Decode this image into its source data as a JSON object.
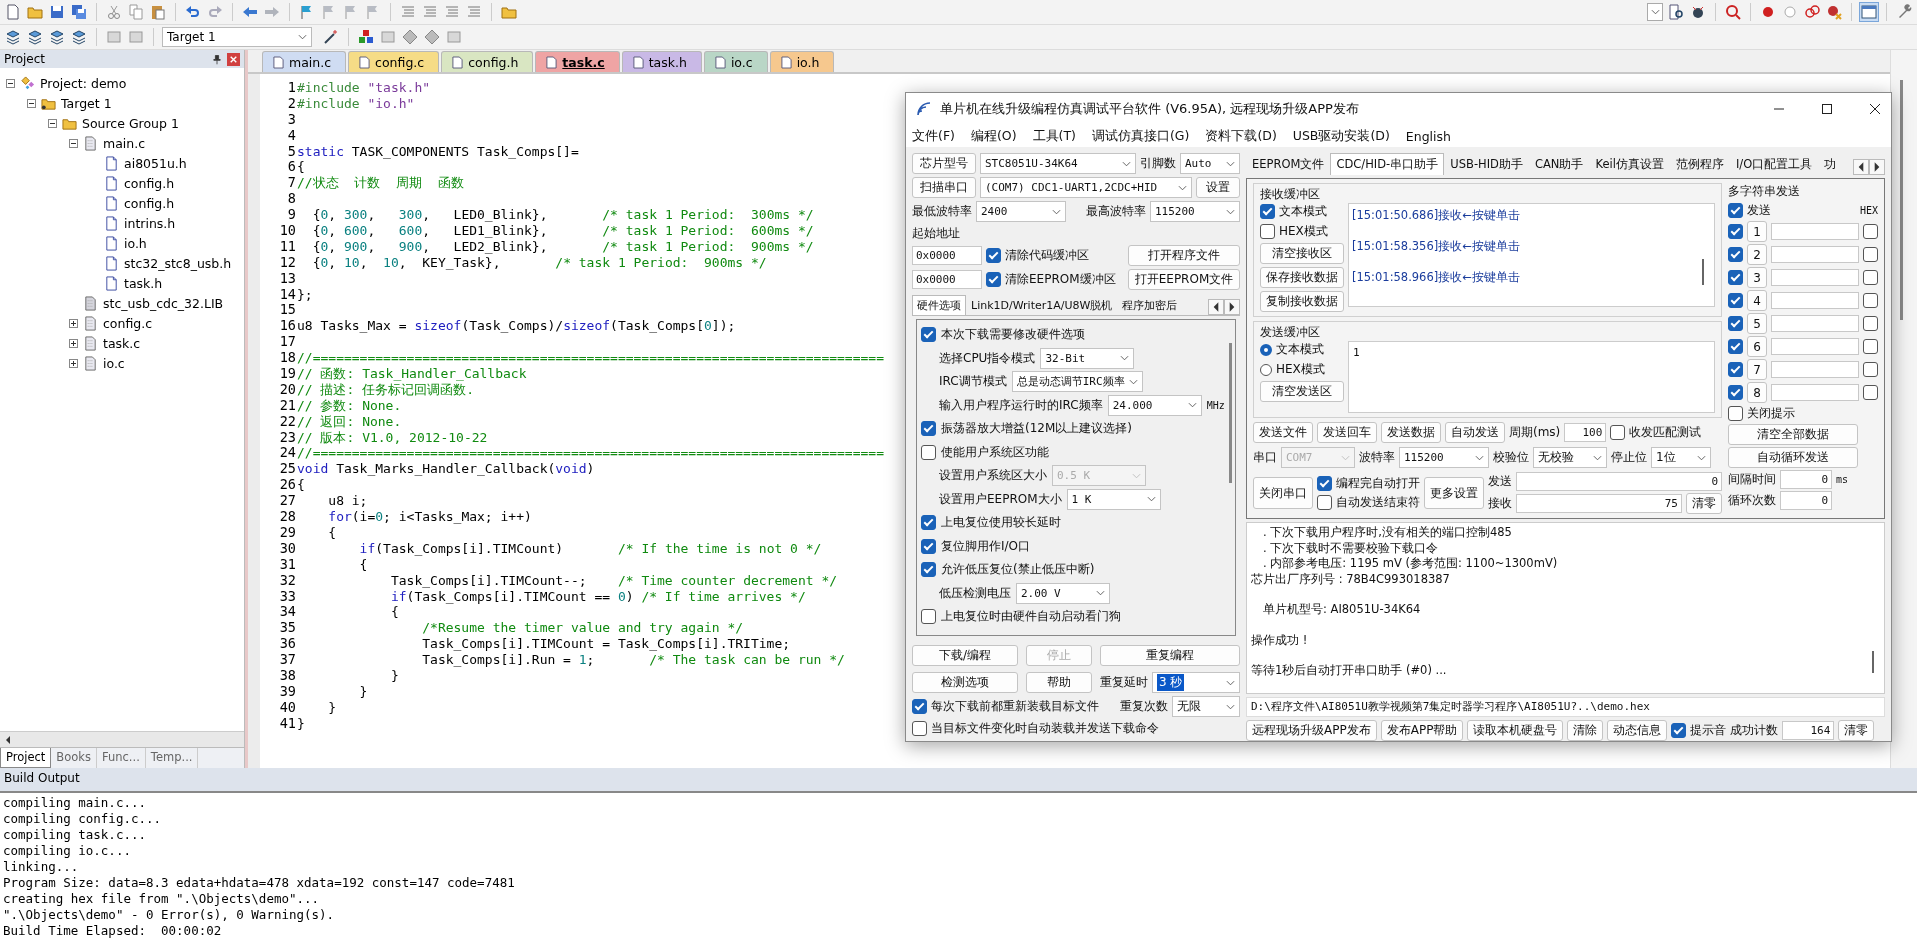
{
  "toolbar": {
    "target": "Target 1"
  },
  "project_panel": {
    "title": "Project",
    "tree": [
      {
        "label": "Project: demo",
        "kind": "project",
        "expanded": true,
        "children": [
          {
            "label": "Target 1",
            "kind": "target",
            "expanded": true,
            "children": [
              {
                "label": "Source Group 1",
                "kind": "group",
                "expanded": true,
                "children": [
                  {
                    "label": "main.c",
                    "kind": "source",
                    "expanded": true,
                    "children": [
                      {
                        "label": "ai8051u.h",
                        "kind": "header"
                      },
                      {
                        "label": "config.h",
                        "kind": "header"
                      },
                      {
                        "label": "config.h",
                        "kind": "header"
                      },
                      {
                        "label": "intrins.h",
                        "kind": "header"
                      },
                      {
                        "label": "io.h",
                        "kind": "header"
                      },
                      {
                        "label": "stc32_stc8_usb.h",
                        "kind": "header"
                      },
                      {
                        "label": "task.h",
                        "kind": "header"
                      }
                    ]
                  },
                  {
                    "label": "stc_usb_cdc_32.LIB",
                    "kind": "library"
                  },
                  {
                    "label": "config.c",
                    "kind": "source",
                    "expanded": false
                  },
                  {
                    "label": "task.c",
                    "kind": "source",
                    "expanded": false
                  },
                  {
                    "label": "io.c",
                    "kind": "source",
                    "expanded": false
                  }
                ]
              }
            ]
          }
        ]
      }
    ],
    "tabs": [
      {
        "label": "Project",
        "selected": true
      },
      {
        "label": "Books",
        "selected": false
      },
      {
        "label": "Func...",
        "selected": false
      },
      {
        "label": "Temp...",
        "selected": false
      }
    ]
  },
  "editor": {
    "tabs": [
      {
        "label": "main.c",
        "color": "#cfdcf2",
        "selected": false
      },
      {
        "label": "config.c",
        "color": "#f6dc86",
        "selected": false
      },
      {
        "label": "config.h",
        "color": "#d9e6c2",
        "selected": false
      },
      {
        "label": "task.c",
        "color": "#efa4a4",
        "selected": true
      },
      {
        "label": "task.h",
        "color": "#c9b9e6",
        "selected": false
      },
      {
        "label": "io.c",
        "color": "#b9d6c6",
        "selected": false
      },
      {
        "label": "io.h",
        "color": "#f6c88e",
        "selected": false
      }
    ],
    "lines": [
      {
        "number": "1",
        "parts": [
          {
            "kind": "pre",
            "text": "#include"
          },
          {
            "kind": "str",
            "text": " \"task.h\""
          }
        ]
      },
      {
        "number": "2",
        "parts": [
          {
            "kind": "pre",
            "text": "#include"
          },
          {
            "kind": "str",
            "text": " \"io.h\""
          }
        ]
      },
      {
        "number": "3"
      },
      {
        "number": "4"
      },
      {
        "number": "5",
        "parts": [
          {
            "kind": "kw",
            "text": "static"
          },
          {
            "kind": "plain",
            "text": " TASK_COMPONENTS Task_Comps[]="
          }
        ]
      },
      {
        "number": "6",
        "parts": [
          {
            "kind": "plain",
            "text": "{"
          }
        ]
      },
      {
        "number": "7",
        "parts": [
          {
            "kind": "cm",
            "text": "//状态  计数  周期  函数"
          }
        ]
      },
      {
        "number": "8"
      },
      {
        "number": "9",
        "parts": [
          {
            "kind": "plain",
            "text": "  {"
          },
          {
            "kind": "num",
            "text": "0"
          },
          {
            "kind": "plain",
            "text": ", "
          },
          {
            "kind": "num",
            "text": "300"
          },
          {
            "kind": "plain",
            "text": ",   "
          },
          {
            "kind": "num",
            "text": "300"
          },
          {
            "kind": "plain",
            "text": ",   LED0_Blink},       "
          },
          {
            "kind": "cm",
            "text": "/* task 1 Period:  300ms */"
          }
        ]
      },
      {
        "number": "10",
        "parts": [
          {
            "kind": "plain",
            "text": "  {"
          },
          {
            "kind": "num",
            "text": "0"
          },
          {
            "kind": "plain",
            "text": ", "
          },
          {
            "kind": "num",
            "text": "600"
          },
          {
            "kind": "plain",
            "text": ",   "
          },
          {
            "kind": "num",
            "text": "600"
          },
          {
            "kind": "plain",
            "text": ",   LED1_Blink},       "
          },
          {
            "kind": "cm",
            "text": "/* task 1 Period:  600ms */"
          }
        ]
      },
      {
        "number": "11",
        "parts": [
          {
            "kind": "plain",
            "text": "  {"
          },
          {
            "kind": "num",
            "text": "0"
          },
          {
            "kind": "plain",
            "text": ", "
          },
          {
            "kind": "num",
            "text": "900"
          },
          {
            "kind": "plain",
            "text": ",   "
          },
          {
            "kind": "num",
            "text": "900"
          },
          {
            "kind": "plain",
            "text": ",   LED2_Blink},       "
          },
          {
            "kind": "cm",
            "text": "/* task 1 Period:  900ms */"
          }
        ]
      },
      {
        "number": "12",
        "parts": [
          {
            "kind": "plain",
            "text": "  {"
          },
          {
            "kind": "num",
            "text": "0"
          },
          {
            "kind": "plain",
            "text": ", "
          },
          {
            "kind": "num",
            "text": "10"
          },
          {
            "kind": "plain",
            "text": ",  "
          },
          {
            "kind": "num",
            "text": "10"
          },
          {
            "kind": "plain",
            "text": ",  KEY_Task},       "
          },
          {
            "kind": "cm",
            "text": "/* task 1 Period:  900ms */"
          }
        ]
      },
      {
        "number": "13"
      },
      {
        "number": "14",
        "parts": [
          {
            "kind": "plain",
            "text": "};"
          }
        ]
      },
      {
        "number": "15"
      },
      {
        "number": "16",
        "parts": [
          {
            "kind": "plain",
            "text": "u8 Tasks_Max = "
          },
          {
            "kind": "kw",
            "text": "sizeof"
          },
          {
            "kind": "plain",
            "text": "(Task_Comps)/"
          },
          {
            "kind": "kw",
            "text": "sizeof"
          },
          {
            "kind": "plain",
            "text": "(Task_Comps["
          },
          {
            "kind": "num",
            "text": "0"
          },
          {
            "kind": "plain",
            "text": "]);"
          }
        ]
      },
      {
        "number": "17"
      },
      {
        "number": "18",
        "parts": [
          {
            "kind": "cm",
            "text": "//========================================================================="
          }
        ]
      },
      {
        "number": "19",
        "parts": [
          {
            "kind": "cm",
            "text": "// 函数: Task_Handler_Callback"
          }
        ]
      },
      {
        "number": "20",
        "parts": [
          {
            "kind": "cm",
            "text": "// 描述: 任务标记回调函数."
          }
        ]
      },
      {
        "number": "21",
        "parts": [
          {
            "kind": "cm",
            "text": "// 参数: None."
          }
        ]
      },
      {
        "number": "22",
        "parts": [
          {
            "kind": "cm",
            "text": "// 返回: None."
          }
        ]
      },
      {
        "number": "23",
        "parts": [
          {
            "kind": "cm",
            "text": "// 版本: V1.0, 2012-10-22"
          }
        ]
      },
      {
        "number": "24",
        "parts": [
          {
            "kind": "cm",
            "text": "//========================================================================="
          }
        ]
      },
      {
        "number": "25",
        "parts": [
          {
            "kind": "kw",
            "text": "void"
          },
          {
            "kind": "plain",
            "text": " Task_Marks_Handler_Callback("
          },
          {
            "kind": "kw",
            "text": "void"
          },
          {
            "kind": "plain",
            "text": ")"
          }
        ]
      },
      {
        "number": "26",
        "parts": [
          {
            "kind": "plain",
            "text": "{"
          }
        ]
      },
      {
        "number": "27",
        "parts": [
          {
            "kind": "plain",
            "text": "    u8 i;"
          }
        ]
      },
      {
        "number": "28",
        "parts": [
          {
            "kind": "kw",
            "text": "    for"
          },
          {
            "kind": "plain",
            "text": "(i="
          },
          {
            "kind": "num",
            "text": "0"
          },
          {
            "kind": "plain",
            "text": "; i<Tasks_Max; i++)"
          }
        ]
      },
      {
        "number": "29",
        "parts": [
          {
            "kind": "plain",
            "text": "    {"
          }
        ]
      },
      {
        "number": "30",
        "parts": [
          {
            "kind": "kw",
            "text": "        if"
          },
          {
            "kind": "plain",
            "text": "(Task_Comps[i].TIMCount)       "
          },
          {
            "kind": "cm",
            "text": "/* If the time is not 0 */"
          }
        ]
      },
      {
        "number": "31",
        "parts": [
          {
            "kind": "plain",
            "text": "        {"
          }
        ]
      },
      {
        "number": "32",
        "parts": [
          {
            "kind": "plain",
            "text": "            Task_Comps[i].TIMCount--;    "
          },
          {
            "kind": "cm",
            "text": "/* Time counter decrement */"
          }
        ]
      },
      {
        "number": "33",
        "parts": [
          {
            "kind": "kw",
            "text": "            if"
          },
          {
            "kind": "plain",
            "text": "(Task_Comps[i].TIMCount == "
          },
          {
            "kind": "num",
            "text": "0"
          },
          {
            "kind": "plain",
            "text": ") "
          },
          {
            "kind": "cm",
            "text": "/* If time arrives */"
          }
        ]
      },
      {
        "number": "34",
        "parts": [
          {
            "kind": "plain",
            "text": "            {"
          }
        ]
      },
      {
        "number": "35",
        "parts": [
          {
            "kind": "cm",
            "text": "                /*Resume the timer value and try again */"
          }
        ]
      },
      {
        "number": "36",
        "parts": [
          {
            "kind": "plain",
            "text": "                Task_Comps[i].TIMCount = Task_Comps[i].TRITime;"
          }
        ]
      },
      {
        "number": "37",
        "parts": [
          {
            "kind": "plain",
            "text": "                Task_Comps[i].Run = "
          },
          {
            "kind": "num",
            "text": "1"
          },
          {
            "kind": "plain",
            "text": ";       "
          },
          {
            "kind": "cm",
            "text": "/* The task can be run */"
          }
        ]
      },
      {
        "number": "38",
        "parts": [
          {
            "kind": "plain",
            "text": "            }"
          }
        ]
      },
      {
        "number": "39",
        "parts": [
          {
            "kind": "plain",
            "text": "        }"
          }
        ]
      },
      {
        "number": "40",
        "parts": [
          {
            "kind": "plain",
            "text": "    }"
          }
        ]
      },
      {
        "number": "41",
        "parts": [
          {
            "kind": "plain",
            "text": "}"
          }
        ]
      }
    ]
  },
  "build_output": {
    "title": "Build Output",
    "lines": [
      "compiling main.c...",
      "compiling config.c...",
      "compiling task.c...",
      "compiling io.c...",
      "linking...",
      "Program Size: data=8.3 edata+hdata=478 xdata=192 const=147 code=7481",
      "creating hex file from \".\\Objects\\demo\"...",
      "\".\\Objects\\demo\" - 0 Error(s), 0 Warning(s).",
      "Build Time Elapsed:  00:00:02"
    ]
  },
  "dialog": {
    "title": "单片机在线升级编程仿真调试平台软件 (V6.95A), 远程现场升级APP发布",
    "menu": [
      "文件(F)",
      "编程(O)",
      "工具(T)",
      "调试仿真接口(G)",
      "资料下载(D)",
      "USB驱动安装(D)",
      "English"
    ],
    "chip": {
      "button": "芯片型号",
      "value": "STC8051U-34K64",
      "pins_label": "引脚数",
      "pins_value": "Auto"
    },
    "port": {
      "button": "扫描串口",
      "value": "(COM7) CDC1-UART1,2CDC+HID",
      "settings_button": "设置"
    },
    "baud": {
      "min_label": "最低波特率",
      "min_value": "2400",
      "max_label": "最高波特率",
      "max_value": "115200"
    },
    "start_address": {
      "label": "起始地址",
      "rows": [
        {
          "address": "0x0000",
          "label": "清除代码缓冲区",
          "checked": true,
          "button": "打开程序文件"
        },
        {
          "address": "0x0000",
          "label": "清除EEPROM缓冲区",
          "checked": true,
          "button": "打开EEPROM文件"
        }
      ]
    },
    "option_tabs": [
      {
        "label": "硬件选项",
        "selected": true
      },
      {
        "label": "Link1D/Writer1A/U8W脱机",
        "selected": false
      },
      {
        "label": "程序加密后",
        "selected": false
      }
    ],
    "options": [
      {
        "kind": "check",
        "label": "本次下载需要修改硬件选项",
        "checked": true
      },
      {
        "kind": "select",
        "label": "选择CPU指令模式",
        "value": "32-Bit",
        "disabled": false
      },
      {
        "kind": "select",
        "label": "IRC调节模式",
        "value": "总是动态调节IRC频率",
        "disabled": false
      },
      {
        "kind": "select",
        "label": "输入用户程序运行时的IRC频率",
        "value": "24.000",
        "unit": "MHz",
        "disabled": false
      },
      {
        "kind": "check",
        "label": "振荡器放大增益(12M以上建议选择)",
        "checked": true
      },
      {
        "kind": "check",
        "label": "使能用户系统区功能",
        "checked": false
      },
      {
        "kind": "select",
        "label": "设置用户系统区大小",
        "value": "0.5 K",
        "disabled": true
      },
      {
        "kind": "select",
        "label": "设置用户EEPROM大小",
        "value": "1    K",
        "disabled": false
      },
      {
        "kind": "check",
        "label": "上电复位使用较长延时",
        "checked": true
      },
      {
        "kind": "check",
        "label": "复位脚用作I/O口",
        "checked": true
      },
      {
        "kind": "check",
        "label": "允许低压复位(禁止低压中断)",
        "checked": true
      },
      {
        "kind": "select",
        "label": "低压检测电压",
        "value": "2.00 V",
        "disabled": false
      },
      {
        "kind": "check",
        "label": "上电复位时由硬件自动启动看门狗",
        "checked": false
      }
    ],
    "actions": {
      "download": "下载/编程",
      "stop": {
        "label": "停止",
        "disabled": true
      },
      "repeat": "重复编程",
      "check": "检测选项",
      "help": "帮助",
      "delay_label": "重复延时",
      "delay_value": "3 秒",
      "count_label": "重复次数",
      "count_value": "无限"
    },
    "reload_options": [
      {
        "label": "每次下载前都重新装载目标文件",
        "checked": true
      },
      {
        "label": "当目标文件变化时自动装载并发送下载命令",
        "checked": false
      }
    ],
    "tool_tabs": [
      {
        "label": "EEPROM文件",
        "selected": false
      },
      {
        "label": "CDC/HID-串口助手",
        "selected": true
      },
      {
        "label": "USB-HID助手",
        "selected": false
      },
      {
        "label": "CAN助手",
        "selected": false
      },
      {
        "label": "Keil仿真设置",
        "selected": false
      },
      {
        "label": "范例程序",
        "selected": false
      },
      {
        "label": "I/O口配置工具",
        "selected": false
      },
      {
        "label": "功",
        "selected": false
      }
    ],
    "receive": {
      "title": "接收缓冲区",
      "modes": [
        {
          "label": "文本模式",
          "checked": true
        },
        {
          "label": "HEX模式",
          "checked": false
        }
      ],
      "buttons": [
        "清空接收区",
        "保存接收数据",
        "复制接收数据"
      ],
      "lines": [
        "[15:01:50.686]接收←按键单击",
        "[15:01:58.356]接收←按键单击",
        "[15:01:58.966]接收←按键单击"
      ]
    },
    "send": {
      "title": "发送缓冲区",
      "modes": [
        {
          "label": "文本模式",
          "selected": true
        },
        {
          "label": "HEX模式",
          "selected": false
        }
      ],
      "clear_button": "清空发送区",
      "value": "1",
      "buttons": [
        "发送文件",
        "发送回车",
        "发送数据",
        "自动发送"
      ],
      "period_label": "周期(ms)",
      "period_value": "100",
      "match_test": {
        "label": "收发匹配测试",
        "checked": false
      }
    },
    "serial": {
      "port_label": "串口",
      "port_value": "COM7",
      "baud_label": "波特率",
      "baud_value": "115200",
      "parity_label": "校验位",
      "parity_value": "无校验",
      "stop_label": "停止位",
      "stop_value": "1位",
      "close_button": "关闭串口",
      "auto_options": [
        {
          "label": "编程完自动打开",
          "checked": true
        },
        {
          "label": "自动发送结束符",
          "checked": false
        }
      ],
      "more_button": "更多设置",
      "sent_label": "发送",
      "sent_value": "0",
      "received_label": "接收",
      "received_value": "75",
      "reset_button": "清零"
    },
    "multi_send": {
      "title": "多字符串发送",
      "send": {
        "label": "发送",
        "checked": true
      },
      "hex_label": "HEX",
      "rows": [
        {
          "label": "1",
          "checked": true,
          "hex": false
        },
        {
          "label": "2",
          "checked": true,
          "hex": false
        },
        {
          "label": "3",
          "checked": true,
          "hex": false
        },
        {
          "label": "4",
          "checked": true,
          "hex": false
        },
        {
          "label": "5",
          "checked": true,
          "hex": false
        },
        {
          "label": "6",
          "checked": true,
          "hex": false
        },
        {
          "label": "7",
          "checked": true,
          "hex": false
        },
        {
          "label": "8",
          "checked": true,
          "hex": false
        }
      ],
      "close_hint": {
        "label": "关闭提示",
        "checked": false
      },
      "buttons": [
        "清空全部数据",
        "自动循环发送"
      ],
      "interval_label": "间隔时间",
      "interval_value": "0",
      "interval_unit": "ms",
      "loops_label": "循环次数",
      "loops_value": "0"
    },
    "log": [
      [
        ". 下次下载用户程序时,没有相关的端口控制485",
        ". 下次下载时不需要校验下载口令",
        ". 内部参考电压: 1195 mV (参考范围: 1100~1300mV)",
        "芯片出厂序列号 : 78B4C993018387"
      ],
      [
        "单片机型号: AI8051U-34K64"
      ],
      [
        "操作成功 !"
      ],
      [
        "等待1秒后自动打开串口助手 (#0) ..."
      ]
    ],
    "path": "D:\\程序文件\\AI8051U教学视频第7集定时器学习程序\\AI8051U?..\\demo.hex",
    "footer": {
      "buttons": [
        "远程现场升级APP发布",
        "发布APP帮助",
        "读取本机硬盘号",
        "清除",
        "动态信息"
      ],
      "sound": {
        "label": "提示音",
        "checked": true
      },
      "count_label": "成功计数",
      "count_value": "164",
      "reset_button": "清零"
    }
  }
}
